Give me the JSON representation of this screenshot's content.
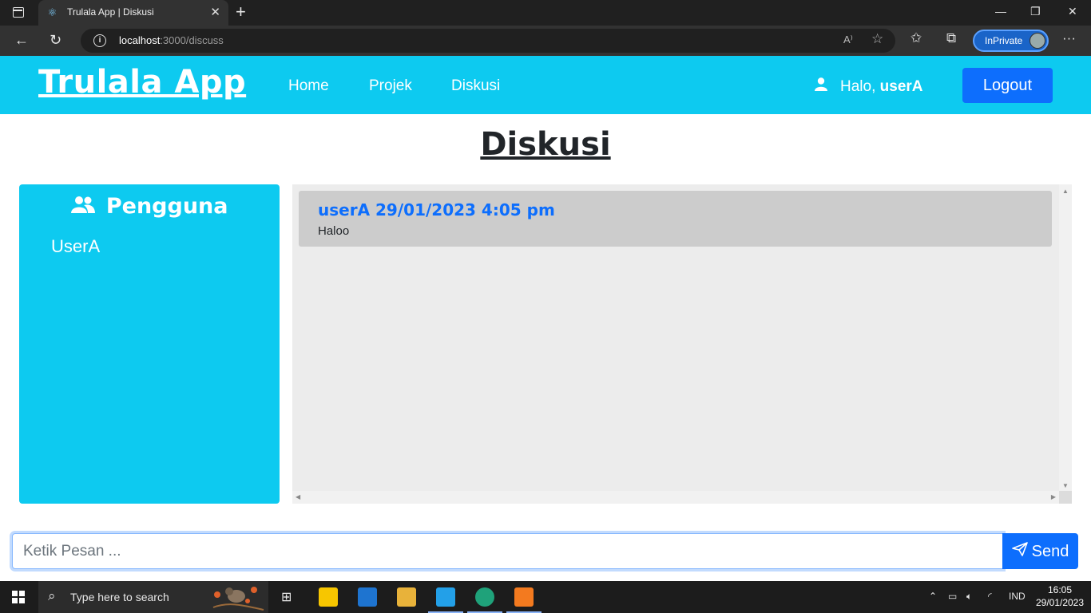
{
  "browser": {
    "tab_title": "Trulala App | Diskusi",
    "url_host": "localhost",
    "url_path": ":3000/discuss",
    "inprivate_label": "InPrivate"
  },
  "app": {
    "brand": "Trulala App",
    "nav": [
      {
        "label": "Home"
      },
      {
        "label": "Projek"
      },
      {
        "label": "Diskusi"
      }
    ],
    "greeting": "Halo, ",
    "username": "userA",
    "logout_label": "Logout"
  },
  "page": {
    "title": "Diskusi"
  },
  "users_panel": {
    "heading": "Pengguna",
    "users": [
      "UserA"
    ]
  },
  "messages": [
    {
      "meta": "userA 29/01/2023 4:05 pm",
      "text": "Haloo"
    }
  ],
  "composer": {
    "placeholder": "Ketik Pesan ...",
    "send_label": "Send"
  },
  "taskbar": {
    "search_placeholder": "Type here to search",
    "lang": "IND",
    "time": "16:05",
    "date": "29/01/2023"
  },
  "colors": {
    "accent": "#0dcaf0",
    "primary": "#0d6efd"
  }
}
